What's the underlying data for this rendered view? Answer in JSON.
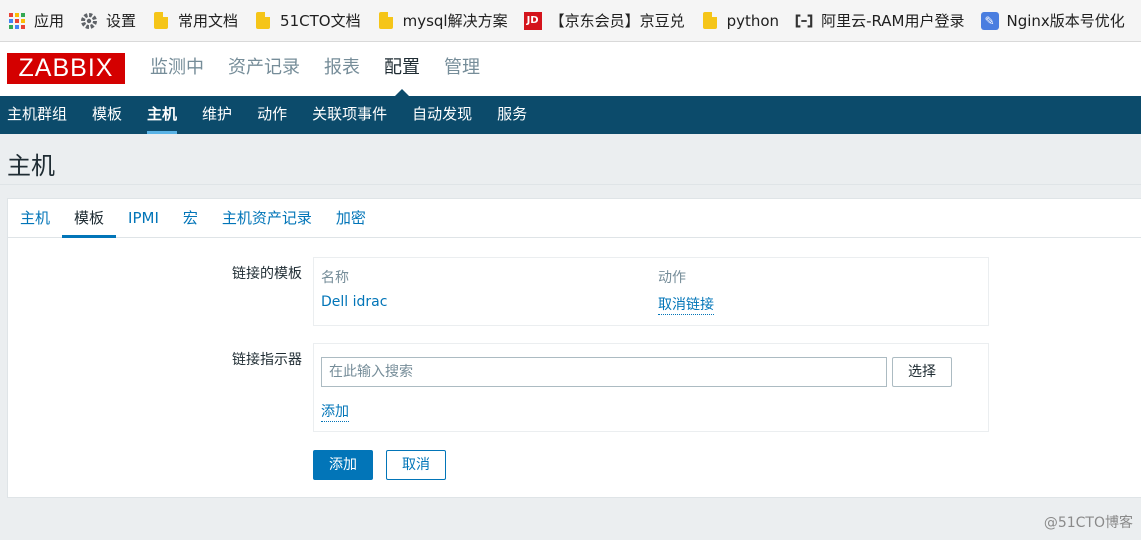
{
  "bookmarks": [
    {
      "label": "应用",
      "icon": "apps-grid-icon"
    },
    {
      "label": "设置",
      "icon": "gear-icon"
    },
    {
      "label": "常用文档",
      "icon": "folder-icon"
    },
    {
      "label": "51CTO文档",
      "icon": "folder-icon"
    },
    {
      "label": "mysql解决方案",
      "icon": "folder-icon"
    },
    {
      "label": "【京东会员】京豆兑换",
      "icon": "jd-icon"
    },
    {
      "label": "python",
      "icon": "folder-icon"
    },
    {
      "label": "阿里云-RAM用户登录",
      "icon": "aliyun-icon"
    },
    {
      "label": "Nginx版本号优化",
      "icon": "nginx-icon"
    }
  ],
  "logo": {
    "text": "ZABBIX"
  },
  "main_menu": [
    "监测中",
    "资产记录",
    "报表",
    "配置",
    "管理"
  ],
  "main_menu_active": "配置",
  "sub_menu": [
    "主机群组",
    "模板",
    "主机",
    "维护",
    "动作",
    "关联项事件",
    "自动发现",
    "服务"
  ],
  "sub_menu_active": "主机",
  "page_title": "主机",
  "tabs": [
    "主机",
    "模板",
    "IPMI",
    "宏",
    "主机资产记录",
    "加密"
  ],
  "tab_active": "模板",
  "linked_templates": {
    "label": "链接的模板",
    "col_name": "名称",
    "col_action": "动作",
    "rows": [
      {
        "name": "Dell idrac",
        "action": "取消链接"
      }
    ]
  },
  "link_indicator": {
    "label": "链接指示器",
    "search_placeholder": "在此输入搜索",
    "select_label": "选择",
    "add_link": "添加"
  },
  "buttons": {
    "add": "添加",
    "cancel": "取消"
  },
  "watermark": "@51CTO博客",
  "colors": {
    "brand_red": "#d40000",
    "nav_blue": "#0c4b6b",
    "link_blue": "#0275b8"
  }
}
